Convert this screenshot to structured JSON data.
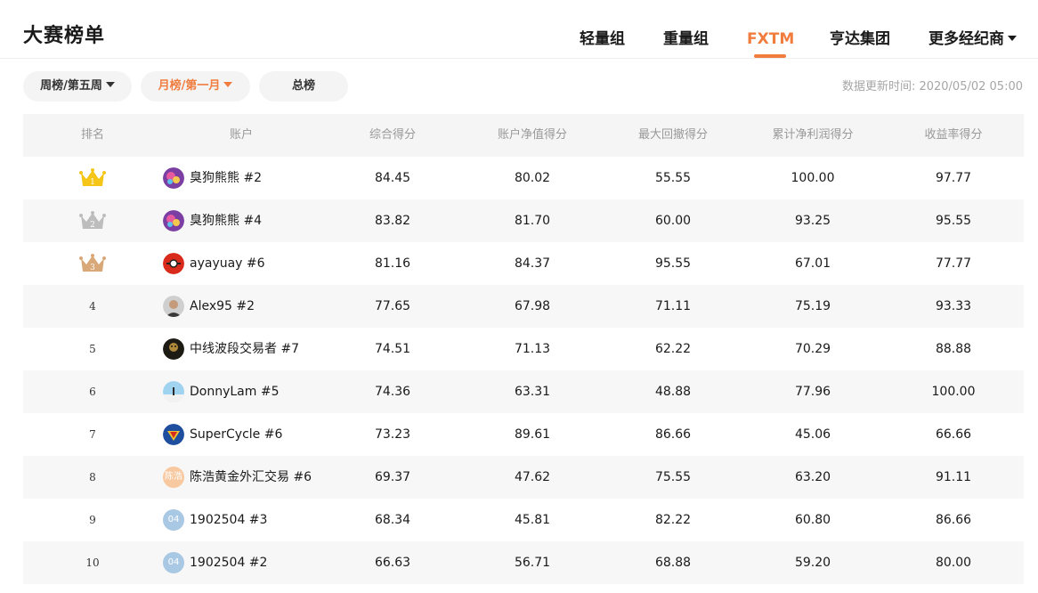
{
  "page_title": "大赛榜单",
  "tabs": [
    {
      "label": "轻量组",
      "active": false
    },
    {
      "label": "重量组",
      "active": false
    },
    {
      "label": "FXTM",
      "active": true
    },
    {
      "label": "亨达集团",
      "active": false
    },
    {
      "label": "更多经纪商",
      "active": false,
      "dropdown": true
    }
  ],
  "filters": {
    "weekly": "周榜/第五周",
    "monthly": "月榜/第一月",
    "total": "总榜"
  },
  "update_time": "数据更新时间: 2020/05/02 05:00",
  "colors": {
    "accent": "#f07c3e",
    "gold": "#f5c518",
    "silver": "#bdbdbd",
    "bronze": "#d9a878"
  },
  "table": {
    "headers": {
      "rank": "排名",
      "account": "账户",
      "overall": "综合得分",
      "equity": "账户净值得分",
      "drawdown": "最大回撤得分",
      "profit": "累计净利润得分",
      "return": "收益率得分"
    },
    "rows": [
      {
        "rank": "1",
        "avatar": "cartoon",
        "name": "臭狗熊熊 #2",
        "overall": "84.45",
        "equity": "80.02",
        "drawdown": "55.55",
        "profit": "100.00",
        "return": "97.77"
      },
      {
        "rank": "2",
        "avatar": "cartoon",
        "name": "臭狗熊熊 #4",
        "overall": "83.82",
        "equity": "81.70",
        "drawdown": "60.00",
        "profit": "93.25",
        "return": "95.55"
      },
      {
        "rank": "3",
        "avatar": "red-ball",
        "name": "ayayuay #6",
        "overall": "81.16",
        "equity": "84.37",
        "drawdown": "95.55",
        "profit": "67.01",
        "return": "77.77"
      },
      {
        "rank": "4",
        "avatar": "person",
        "name": "Alex95 #2",
        "overall": "77.65",
        "equity": "67.98",
        "drawdown": "71.11",
        "profit": "75.19",
        "return": "93.33"
      },
      {
        "rank": "5",
        "avatar": "dark-figure",
        "name": "中线波段交易者 #7",
        "overall": "74.51",
        "equity": "71.13",
        "drawdown": "62.22",
        "profit": "70.29",
        "return": "88.88"
      },
      {
        "rank": "6",
        "avatar": "sky",
        "name": "DonnyLam #5",
        "overall": "74.36",
        "equity": "63.31",
        "drawdown": "48.88",
        "profit": "77.96",
        "return": "100.00"
      },
      {
        "rank": "7",
        "avatar": "superman",
        "name": "SuperCycle #6",
        "overall": "73.23",
        "equity": "89.61",
        "drawdown": "86.66",
        "profit": "45.06",
        "return": "66.66"
      },
      {
        "rank": "8",
        "avatar": "text-peach",
        "avatar_text": "陈浩",
        "name": "陈浩黄金外汇交易 #6",
        "overall": "69.37",
        "equity": "47.62",
        "drawdown": "75.55",
        "profit": "63.20",
        "return": "91.11"
      },
      {
        "rank": "9",
        "avatar": "text-blue",
        "avatar_text": "04",
        "name": "1902504 #3",
        "overall": "68.34",
        "equity": "45.81",
        "drawdown": "82.22",
        "profit": "60.80",
        "return": "86.66"
      },
      {
        "rank": "10",
        "avatar": "text-blue",
        "avatar_text": "04",
        "name": "1902504 #2",
        "overall": "66.63",
        "equity": "56.71",
        "drawdown": "68.88",
        "profit": "59.20",
        "return": "80.00"
      }
    ]
  }
}
